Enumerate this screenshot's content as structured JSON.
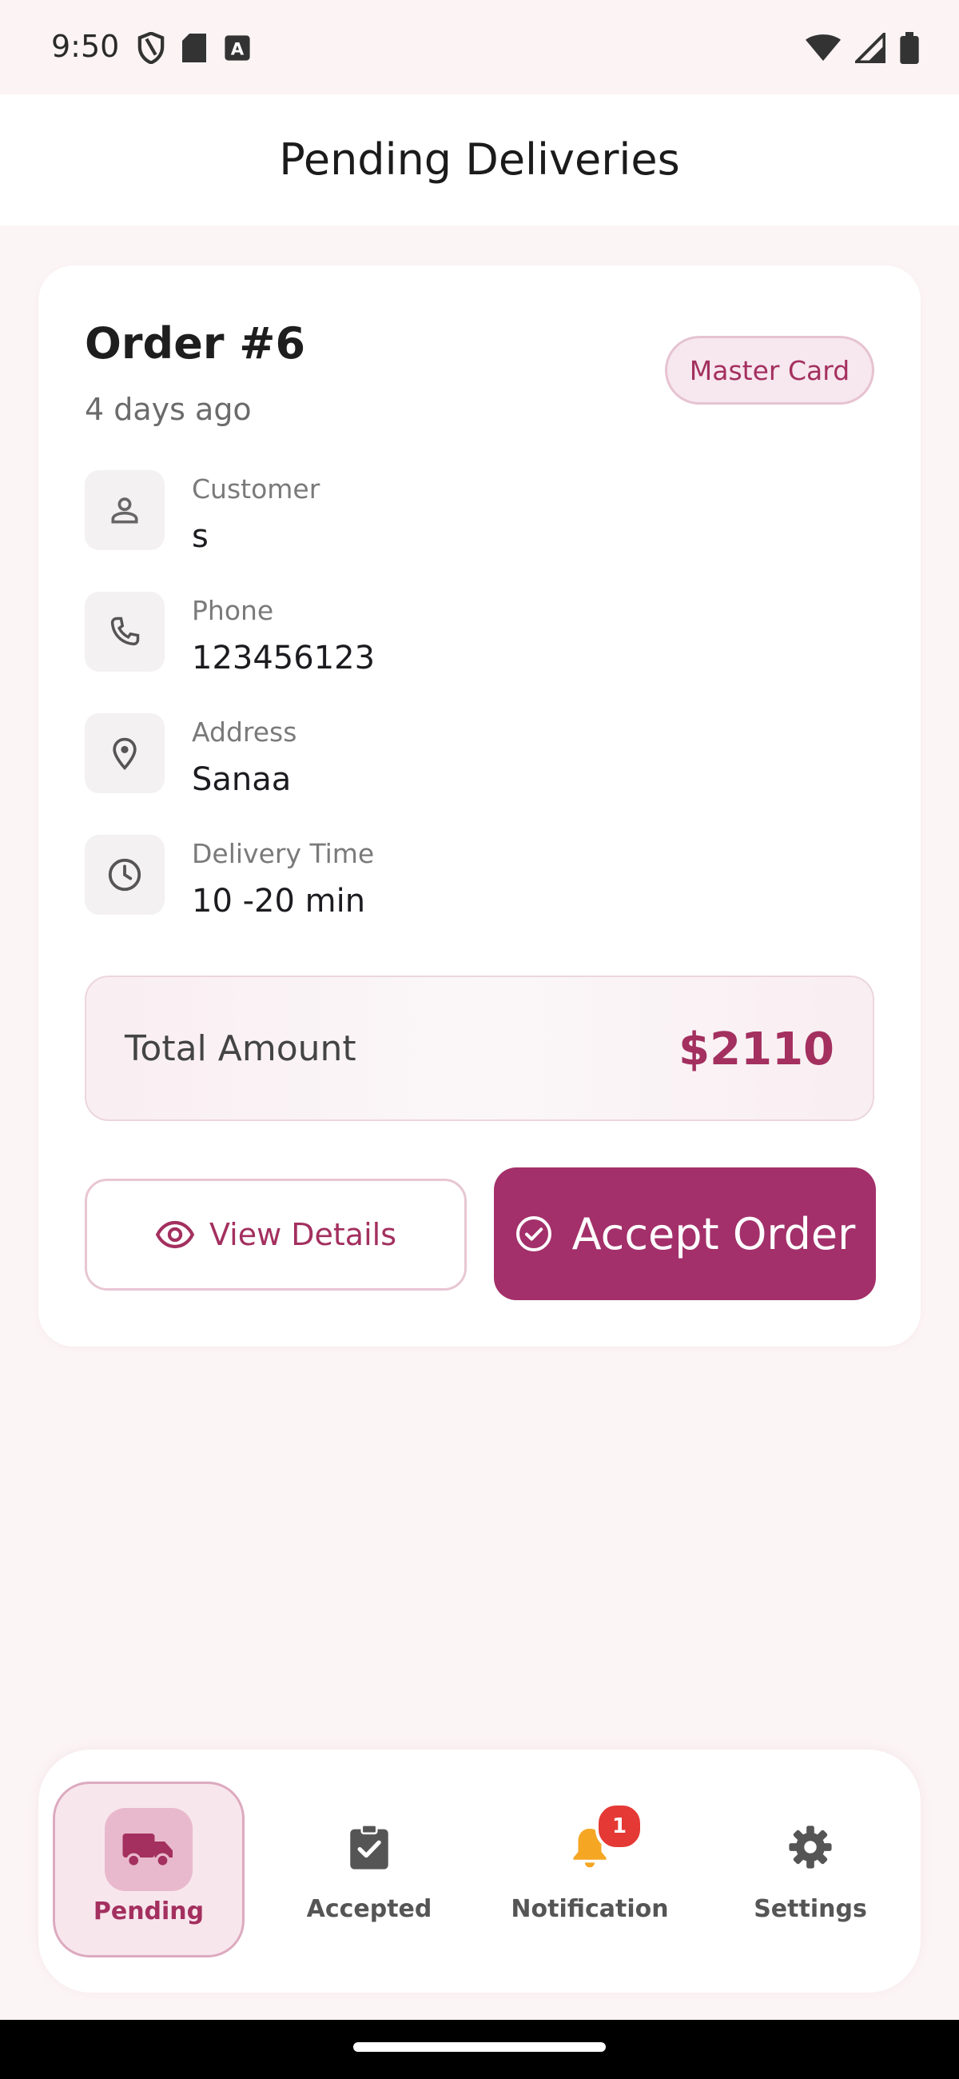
{
  "status_bar": {
    "time": "9:50"
  },
  "app_bar": {
    "title": "Pending Deliveries"
  },
  "order": {
    "title": "Order #6",
    "age": "4 days ago",
    "payment_method": "Master Card",
    "fields": [
      {
        "label": "Customer",
        "value": "s",
        "icon": "person-icon"
      },
      {
        "label": "Phone",
        "value": "123456123",
        "icon": "phone-icon"
      },
      {
        "label": "Address",
        "value": "Sanaa",
        "icon": "location-pin-icon"
      },
      {
        "label": "Delivery Time",
        "value": "10 -20 min",
        "icon": "clock-icon"
      }
    ],
    "total_label": "Total Amount",
    "total_value": "$2110",
    "view_details_label": "View Details",
    "accept_label": "Accept Order"
  },
  "bottom_nav": {
    "items": [
      {
        "label": "Pending",
        "icon": "truck-icon",
        "active": true
      },
      {
        "label": "Accepted",
        "icon": "clipboard-check-icon",
        "active": false
      },
      {
        "label": "Notification",
        "icon": "bell-icon",
        "active": false,
        "badge": "1"
      },
      {
        "label": "Settings",
        "icon": "gear-icon",
        "active": false
      }
    ]
  },
  "colors": {
    "primary": "#a3306a",
    "accent_text": "#a3305f",
    "background": "#fcf5f6",
    "notification_badge": "#e53935",
    "bell": "#f5a623"
  }
}
